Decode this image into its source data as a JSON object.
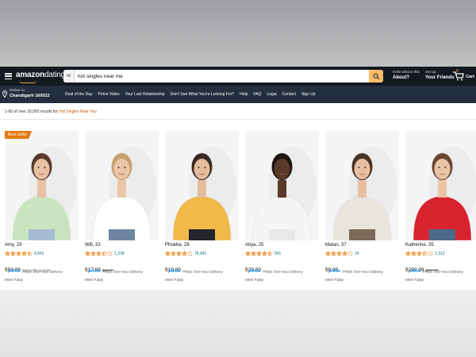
{
  "header": {
    "logo_brand": "amazon",
    "logo_suffix": "dating",
    "search_category": "All",
    "search_value": "hot singles near me",
    "about_small": "Hello what is this",
    "about_big": "About?",
    "friends_small": "Set Up",
    "friends_big": "Your Friends",
    "cart_count": "0",
    "cart_label": "Cart",
    "deliver_small": "Deliver to",
    "deliver_big": "Chandigarh 160022",
    "nav_items": [
      "Deal of the Day",
      "Prime Video",
      "Your Last Relationship",
      "Don't See What You're Looking For?",
      "Help",
      "FAQ",
      "Legal",
      "Contact",
      "Sign Up"
    ],
    "accent": "#febd69",
    "nav_dark": "#131921",
    "nav_sub": "#232f3e"
  },
  "results": {
    "prefix": "1-60 of over 20,000 results for ",
    "query": "Hot Singles Near You"
  },
  "products": [
    {
      "badge": "Best Seller",
      "name": "Amy, 29",
      "rating": 4.5,
      "reviews": "4,941",
      "price": "$59.99",
      "old_price": "",
      "note": "Subscribe & Save",
      "prime": "prime",
      "delivery": "FREE One-Hour Delivery",
      "meet": "Meet Today",
      "top_color": "#c9e5bf",
      "hair": "#5a3b2c",
      "skin": "#e9c2a4",
      "bottom_color": "#a6bcd4"
    },
    {
      "badge": "",
      "name": "Will, 33",
      "rating": 3.5,
      "reviews": "1,338",
      "price": "$17.99",
      "old_price": "$28.99",
      "note": "",
      "prime": "prime",
      "delivery": "FREE One-Hour Delivery",
      "meet": "Meet Today",
      "top_color": "#ffffff",
      "hair": "#c8a070",
      "skin": "#eac5a8",
      "bottom_color": "#6f86a3"
    },
    {
      "badge": "",
      "name": "Phoebe, 28",
      "rating": 4.0,
      "reviews": "78,941",
      "price": "$19.99",
      "old_price": "",
      "note": "",
      "prime": "prime",
      "delivery": "FREE One-Hour Delivery",
      "meet": "Meet Today",
      "top_color": "#f1b84a",
      "hair": "#3a2a24",
      "skin": "#e5bc9c",
      "bottom_color": "#23252b"
    },
    {
      "badge": "",
      "name": "Atiya, 25",
      "rating": 4.5,
      "reviews": "941",
      "price": "$29.99",
      "old_price": "",
      "note": "",
      "prime": "prime",
      "delivery": "FREE One-Hour Delivery",
      "meet": "Meet Today",
      "top_color": "#f5f5f5",
      "hair": "#1e1714",
      "skin": "#5b3a2a",
      "bottom_color": "#e8e8e8"
    },
    {
      "badge": "",
      "name": "Matan, 37",
      "rating": 4.0,
      "reviews": "19",
      "price": "$9.99",
      "old_price": "",
      "note": "",
      "prime": "prime",
      "delivery": "FREE One-Hour Delivery",
      "meet": "Meet Today",
      "top_color": "#e9e4dc",
      "hair": "#4a3424",
      "skin": "#e7c0a2",
      "bottom_color": "#7b6a58"
    },
    {
      "badge": "",
      "name": "Katherine, 35",
      "rating": 3.5,
      "reviews": "2,312",
      "price": "$299.99",
      "old_price": "$300.00",
      "note": "",
      "prime": "prime",
      "delivery": "FREE One-Hour Delivery",
      "meet": "Meet Today",
      "top_color": "#d8232f",
      "hair": "#6a4634",
      "skin": "#eac4a6",
      "bottom_color": "#4a6b8c"
    }
  ],
  "icons": {
    "menu": "hamburger-icon",
    "search": "search-icon",
    "cart": "cart-icon",
    "location": "location-pin-icon",
    "star": "star-icon"
  }
}
